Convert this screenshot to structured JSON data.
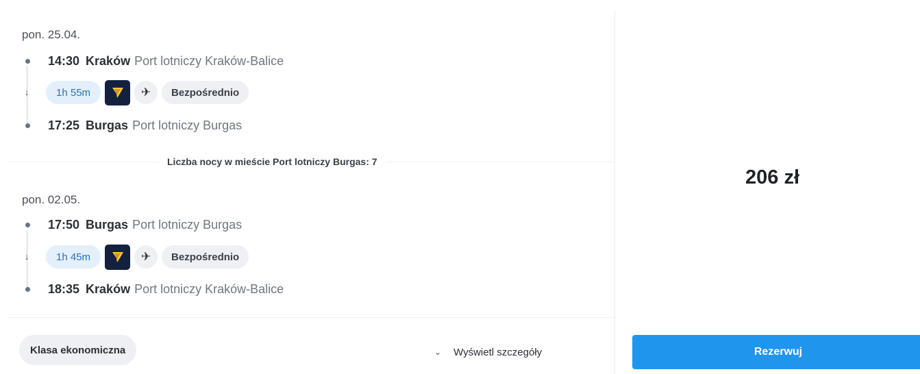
{
  "outbound": {
    "date": "pon. 25.04.",
    "departure": {
      "time": "14:30",
      "city": "Kraków",
      "airport": "Port lotniczy Kraków-Balice"
    },
    "duration": "1h 55m",
    "carrier_icon": "ryanair-harp-logo",
    "plane_icon": "plane-icon",
    "stops": "Bezpośrednio",
    "arrival": {
      "time": "17:25",
      "city": "Burgas",
      "airport": "Port lotniczy Burgas"
    }
  },
  "nights_label": "Liczba nocy w mieście Port lotniczy Burgas: 7",
  "inbound": {
    "date": "pon. 02.05.",
    "departure": {
      "time": "17:50",
      "city": "Burgas",
      "airport": "Port lotniczy Burgas"
    },
    "duration": "1h 45m",
    "carrier_icon": "ryanair-harp-logo",
    "plane_icon": "plane-icon",
    "stops": "Bezpośrednio",
    "arrival": {
      "time": "18:35",
      "city": "Kraków",
      "airport": "Port lotniczy Kraków-Balice"
    }
  },
  "footer": {
    "cabin_class": "Klasa ekonomiczna",
    "details_label": "Wyświetl szczegóły"
  },
  "summary": {
    "price": "206 zł",
    "book_label": "Rezerwuj"
  },
  "colors": {
    "accent": "#1f95ee",
    "duration_bg": "#e3f0fb",
    "carrier_bg": "#13213f",
    "carrier_logo": "#f1c933"
  }
}
